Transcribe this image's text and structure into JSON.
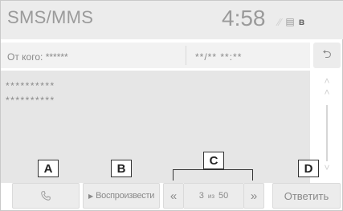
{
  "header": {
    "title": "SMS/MMS",
    "time": "4:58",
    "status_icons": [
      "antenna-icon",
      "phone-battery-icon",
      "bluetooth-icon"
    ]
  },
  "message": {
    "from_label": "От кого:",
    "from_value": "******",
    "datetime": "**/** **:**",
    "body_lines": [
      "**********",
      "**********"
    ]
  },
  "controls": {
    "call_icon": "phone-icon",
    "play_label": "Воспроизвести",
    "prev_label": "«",
    "page_current": "3",
    "page_of": "из",
    "page_total": "50",
    "next_label": "»",
    "reply_label": "Ответить",
    "back_icon": "back-arrow-icon",
    "scroll_up_icon": "chevron-up-icon",
    "scroll_down_icon": "chevron-down-icon"
  },
  "callouts": {
    "a": "A",
    "b": "B",
    "c": "C",
    "d": "D"
  }
}
